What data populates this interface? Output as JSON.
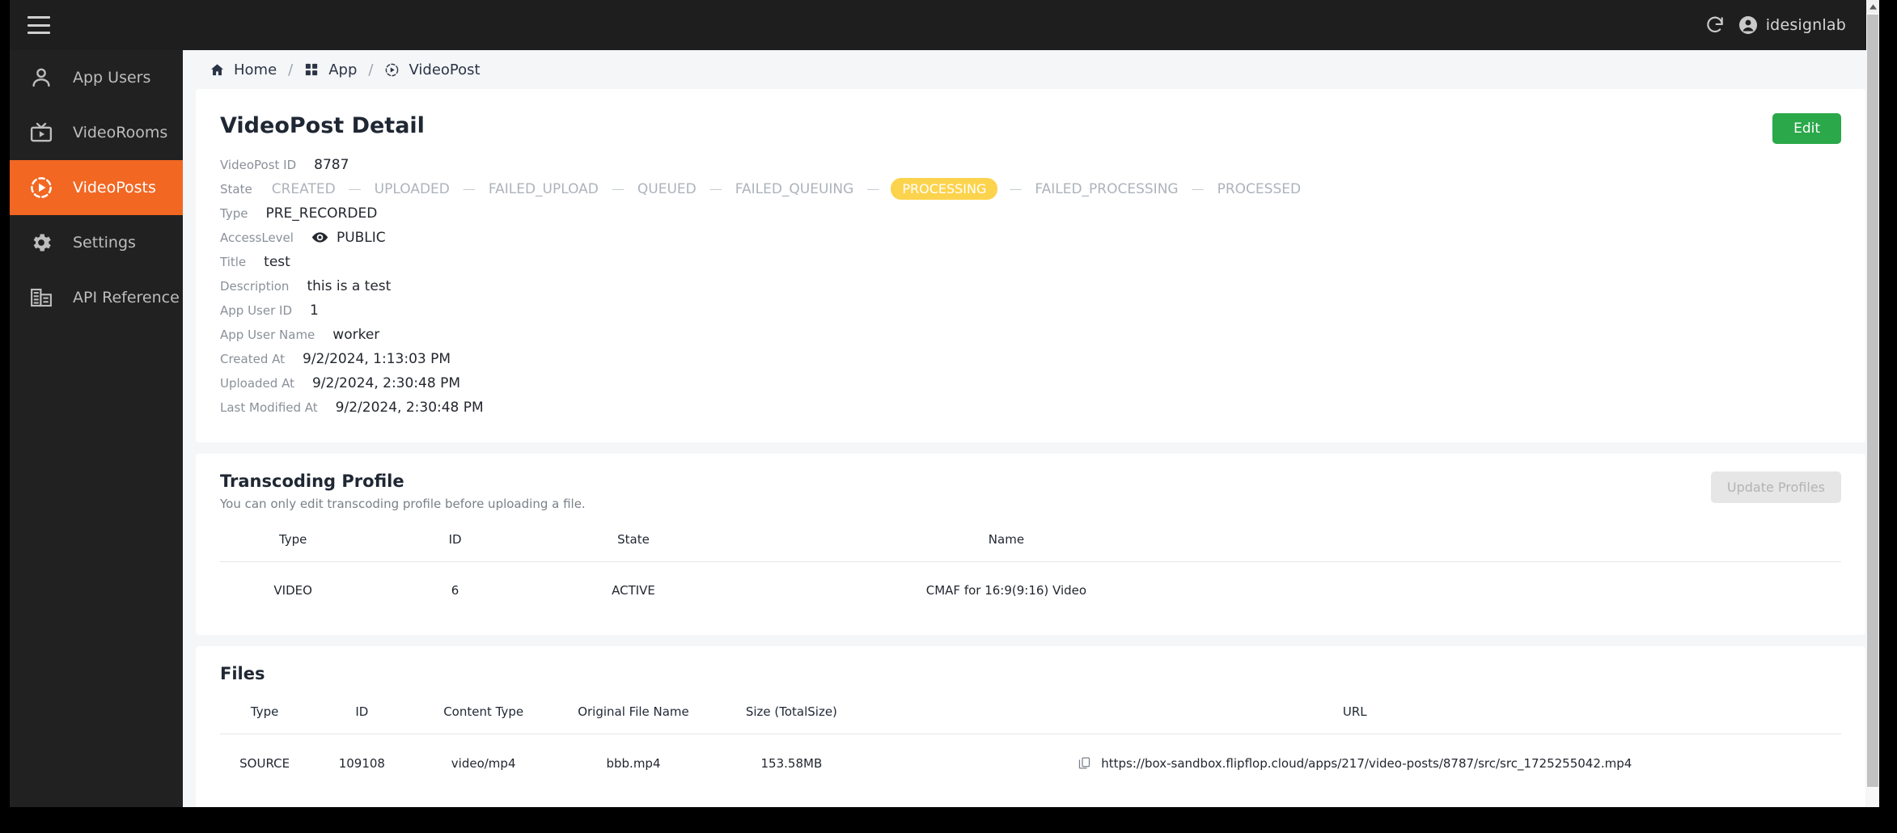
{
  "topbar": {
    "menu_icon": "hamburger-icon",
    "refresh_icon": "refresh-icon",
    "account_icon": "account-circle-icon",
    "user_name": "idesignlab"
  },
  "sidebar": {
    "items": [
      {
        "label": "App Users",
        "icon": "person-icon",
        "active": false,
        "external": false
      },
      {
        "label": "VideoRooms",
        "icon": "tv-play-icon",
        "active": false,
        "external": false
      },
      {
        "label": "VideoPosts",
        "icon": "play-circle-icon",
        "active": true,
        "external": false
      },
      {
        "label": "Settings",
        "icon": "gear-icon",
        "active": false,
        "external": false
      },
      {
        "label": "API Reference",
        "icon": "building-icon",
        "active": false,
        "external": true
      }
    ],
    "active_color": "#f26722"
  },
  "breadcrumb": {
    "home": "Home",
    "app": "App",
    "current": "VideoPost",
    "separator": "/"
  },
  "detail": {
    "title": "VideoPost Detail",
    "edit_label": "Edit",
    "edit_color": "#2ba84a",
    "fields": {
      "videopost_id": {
        "label": "VideoPost ID",
        "value": "8787"
      },
      "state": {
        "label": "State"
      },
      "type": {
        "label": "Type",
        "value": "PRE_RECORDED"
      },
      "access_level": {
        "label": "AccessLevel",
        "value": "PUBLIC",
        "icon": "eye-icon"
      },
      "title": {
        "label": "Title",
        "value": "test"
      },
      "description": {
        "label": "Description",
        "value": "this is a test"
      },
      "app_user_id": {
        "label": "App User ID",
        "value": "1"
      },
      "app_user_name": {
        "label": "App User Name",
        "value": "worker"
      },
      "created_at": {
        "label": "Created At",
        "value": "9/2/2024, 1:13:03 PM"
      },
      "uploaded_at": {
        "label": "Uploaded At",
        "value": "9/2/2024, 2:30:48 PM"
      },
      "last_modified": {
        "label": "Last Modified At",
        "value": "9/2/2024, 2:30:48 PM"
      }
    },
    "state_chain": {
      "steps": [
        "CREATED",
        "UPLOADED",
        "FAILED_UPLOAD",
        "QUEUED",
        "FAILED_QUEUING",
        "PROCESSING",
        "FAILED_PROCESSING",
        "PROCESSED"
      ],
      "current": "PROCESSING",
      "current_color": "#fcd34d",
      "dash": "—"
    }
  },
  "transcoding": {
    "title": "Transcoding Profile",
    "subtitle": "You can only edit transcoding profile before uploading a file.",
    "update_label": "Update Profiles",
    "update_disabled": true,
    "columns": [
      "Type",
      "ID",
      "State",
      "Name"
    ],
    "rows": [
      {
        "type": "VIDEO",
        "id": "6",
        "state": "ACTIVE",
        "name": "CMAF for 16:9(9:16) Video"
      }
    ]
  },
  "files": {
    "title": "Files",
    "columns": [
      "Type",
      "ID",
      "Content Type",
      "Original File Name",
      "Size (TotalSize)",
      "URL"
    ],
    "rows": [
      {
        "type": "SOURCE",
        "id": "109108",
        "content_type": "video/mp4",
        "original_file_name": "bbb.mp4",
        "size": "153.58MB",
        "url": "https://box-sandbox.flipflop.cloud/apps/217/video-posts/8787/src/src_1725255042.mp4",
        "copy_icon": "copy-icon"
      }
    ]
  },
  "scrollbar": {
    "up_arrow": "chevron-up-icon",
    "down_arrow": "chevron-down-icon"
  }
}
